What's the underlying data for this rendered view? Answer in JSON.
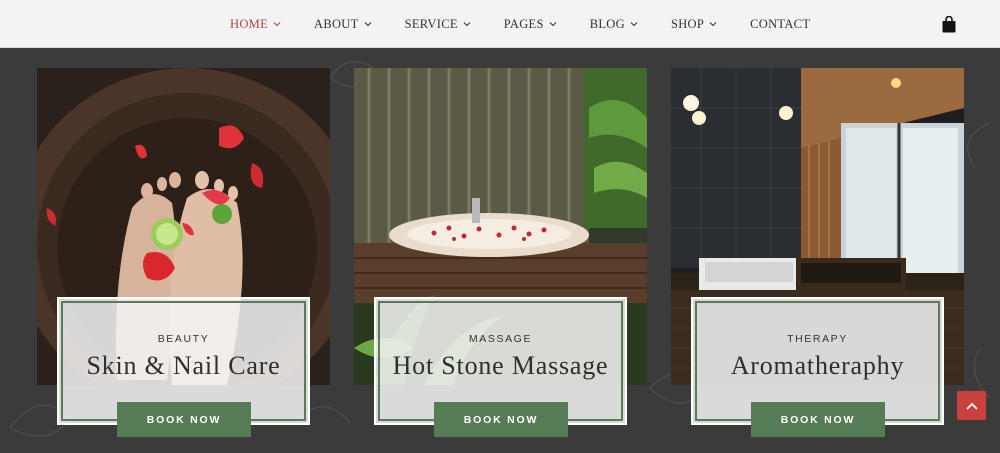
{
  "nav": {
    "items": [
      {
        "label": "HOME",
        "active": true,
        "dropdown": true
      },
      {
        "label": "ABOUT",
        "dropdown": true
      },
      {
        "label": "SERVICE",
        "dropdown": true
      },
      {
        "label": "PAGES",
        "dropdown": true
      },
      {
        "label": "BLOG",
        "dropdown": true
      },
      {
        "label": "SHOP",
        "dropdown": true
      },
      {
        "label": "CONTACT",
        "dropdown": false
      }
    ],
    "cart_icon": "shopping-bag-icon"
  },
  "cards": [
    {
      "category": "BEAUTY",
      "title": "Skin & Nail Care",
      "button": "BOOK NOW",
      "image": "foot-spa-bowl-with-rose-petals"
    },
    {
      "category": "MASSAGE",
      "title": "Hot Stone Massage",
      "button": "BOOK NOW",
      "image": "outdoor-tub-with-petals"
    },
    {
      "category": "THERAPY",
      "title": "Aromatheraphy",
      "button": "BOOK NOW",
      "image": "modern-bathroom-with-bathtub"
    }
  ],
  "colors": {
    "accent": "#b0443e",
    "button": "#567c55",
    "background": "#3b3b3b",
    "scroll_top": "#c8413c"
  },
  "scroll_top_icon": "chevron-up-icon"
}
